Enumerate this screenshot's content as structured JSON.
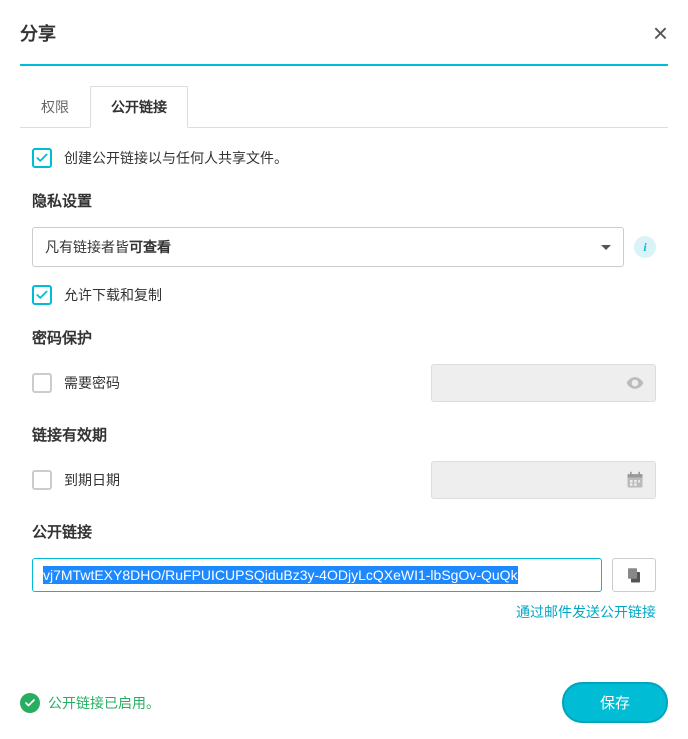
{
  "header": {
    "title": "分享"
  },
  "tabs": {
    "permissions": "权限",
    "public_link": "公开链接"
  },
  "create_link": {
    "label": "创建公开链接以与任何人共享文件。"
  },
  "privacy": {
    "title": "隐私设置",
    "select_prefix": "凡有链接者皆",
    "select_bold": "可查看",
    "allow_download_label": "允许下载和复制"
  },
  "password": {
    "title": "密码保护",
    "require_label": "需要密码"
  },
  "expiry": {
    "title": "链接有效期",
    "date_label": "到期日期"
  },
  "public_link": {
    "title": "公开链接",
    "url_visible": "vj7MTwtEXY8DHO/RuFPUICUPSQiduBz3y-4ODjyLcQXeWI1-lbSgOv-QuQk",
    "send_email": "通过邮件发送公开链接"
  },
  "footer": {
    "status": "公开链接已启用。",
    "save": "保存"
  }
}
